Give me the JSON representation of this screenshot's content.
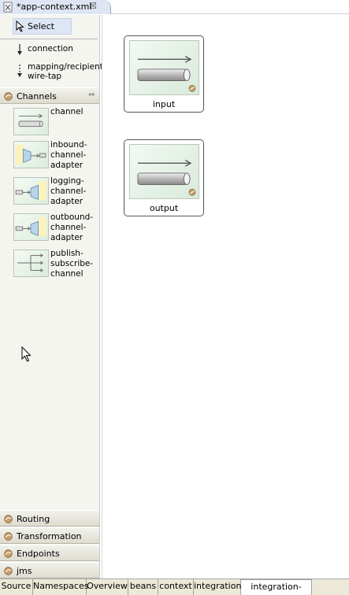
{
  "editor_tab": {
    "title": "*app-context.xml",
    "close_glyph": "☒"
  },
  "palette": {
    "tools": [
      {
        "label": "Select"
      },
      {
        "label": "connection"
      },
      {
        "label": "mapping/recipient/\nwire-tap"
      }
    ],
    "drawers": {
      "channels": "Channels",
      "routing": "Routing",
      "transformation": "Transformation",
      "endpoints": "Endpoints",
      "jms": "jms"
    },
    "channel_items": [
      {
        "label": "channel",
        "icon": "channel-icon"
      },
      {
        "label": "inbound-\nchannel-\nadapter",
        "icon": "inbound-channel-adapter-icon"
      },
      {
        "label": "logging-\nchannel-\nadapter",
        "icon": "logging-channel-adapter-icon"
      },
      {
        "label": "outbound-\nchannel-\nadapter",
        "icon": "outbound-channel-adapter-icon"
      },
      {
        "label": "publish-\nsubscribe-\nchannel",
        "icon": "publish-subscribe-channel-icon"
      }
    ]
  },
  "canvas": {
    "nodes": [
      {
        "label": "input"
      },
      {
        "label": "output"
      }
    ]
  },
  "bottom_tabs": [
    {
      "label": "Source"
    },
    {
      "label": "Namespaces"
    },
    {
      "label": "Overview"
    },
    {
      "label": "beans"
    },
    {
      "label": "context"
    },
    {
      "label": "integration"
    },
    {
      "label": "integration-graph",
      "active": true
    }
  ]
}
